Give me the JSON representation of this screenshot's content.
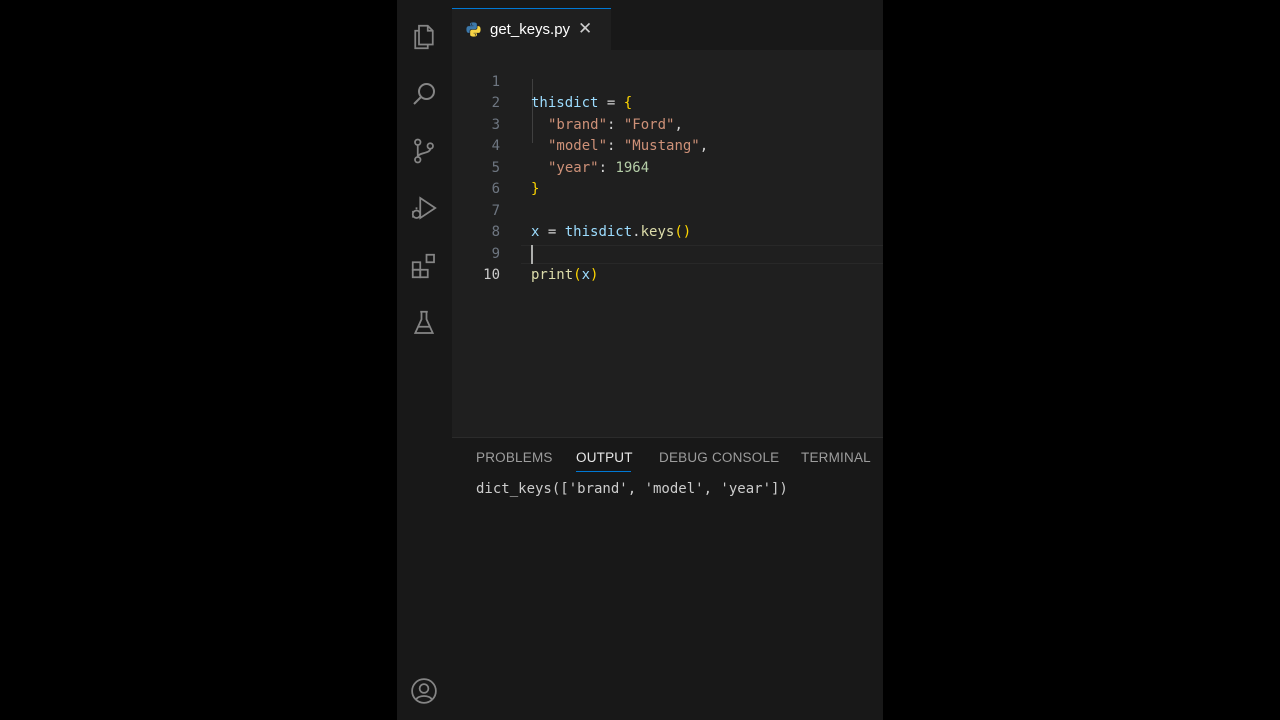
{
  "tab": {
    "filename": "get_keys.py",
    "close_glyph": "✕",
    "icon": "python-icon"
  },
  "activity_bar": {
    "icons": [
      "explorer-icon",
      "search-icon",
      "source-control-icon",
      "run-debug-icon",
      "extensions-icon",
      "testing-icon",
      "accounts-icon"
    ]
  },
  "editor": {
    "lines": [
      {
        "n": "1"
      },
      {
        "n": "2"
      },
      {
        "n": "3"
      },
      {
        "n": "4"
      },
      {
        "n": "5"
      },
      {
        "n": "6"
      },
      {
        "n": "7"
      },
      {
        "n": "8"
      },
      {
        "n": "9"
      },
      {
        "n": "10"
      }
    ],
    "tokens": {
      "l1_var": "thisdict",
      "l1_op": " = ",
      "l1_brace": "{",
      "l2_key": "\"brand\"",
      "l2_colon": ": ",
      "l2_val": "\"Ford\"",
      "l2_comma": ",",
      "l3_key": "\"model\"",
      "l3_colon": ": ",
      "l3_val": "\"Mustang\"",
      "l3_comma": ",",
      "l4_key": "\"year\"",
      "l4_colon": ": ",
      "l4_val": "1964",
      "l5_brace": "}",
      "l7_var": "x",
      "l7_op": " = ",
      "l7_obj": "thisdict",
      "l7_dot": ".",
      "l7_fn": "keys",
      "l7_parens": "()",
      "l9_fn": "print",
      "l9_open": "(",
      "l9_arg": "x",
      "l9_close": ")"
    },
    "current_line": "10"
  },
  "panel": {
    "tabs": [
      "PROBLEMS",
      "OUTPUT",
      "DEBUG CONSOLE",
      "TERMINAL"
    ],
    "active_tab": "OUTPUT",
    "output": "dict_keys(['brand', 'model', 'year'])"
  },
  "colors": {
    "accent": "#0078d4",
    "string": "#ce9178",
    "variable": "#9cdcfe",
    "number": "#b5cea8",
    "function": "#dcdcaa",
    "bracket": "#ffd700"
  }
}
